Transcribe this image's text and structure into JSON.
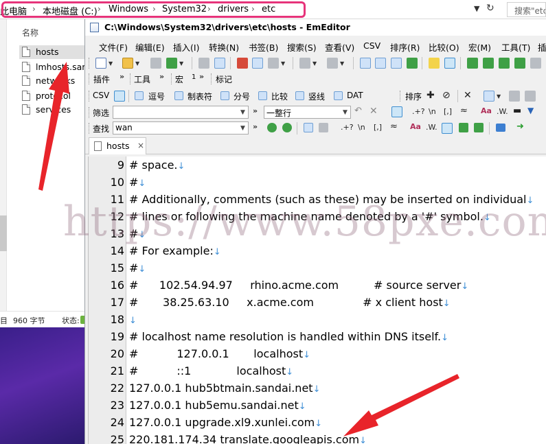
{
  "explorer": {
    "breadcrumb": [
      "此电脑",
      "本地磁盘 (C:)",
      "Windows",
      "System32",
      "drivers",
      "etc"
    ],
    "search_placeholder": "搜索\"etc\"",
    "column_header": "名称",
    "files": [
      {
        "name": "hosts",
        "selected": true
      },
      {
        "name": "lmhosts.sam",
        "selected": false
      },
      {
        "name": "networks",
        "selected": false
      },
      {
        "name": "protocol",
        "selected": false
      },
      {
        "name": "services",
        "selected": false
      }
    ],
    "status": {
      "count_suffix": "目",
      "size": "960 字节",
      "label": "状态:"
    }
  },
  "editor": {
    "title": "C:\\Windows\\System32\\drivers\\etc\\hosts - EmEditor",
    "menu": [
      "文件(F)",
      "编辑(E)",
      "插入(I)",
      "转换(N)",
      "书签(B)",
      "搜索(S)",
      "查看(V)",
      "CSV",
      "排序(R)",
      "比较(O)",
      "宏(M)",
      "工具(T)",
      "插"
    ],
    "toolbar2": {
      "plugins": "插件",
      "tools": "工具",
      "macro": "宏",
      "macro_extra": "1",
      "marks": "标记"
    },
    "csv_bar": {
      "csv": "CSV",
      "comma": "逗号",
      "tab": "制表符",
      "semicolon": "分号",
      "compare": "比较",
      "bar": "竖线",
      "dat": "DAT",
      "sort": "排序"
    },
    "filter_bar": {
      "label": "筛选",
      "value": "",
      "mode": "一整行"
    },
    "find_bar": {
      "label": "查找",
      "value": "wan"
    },
    "toolbar_glyphs": {
      "regex": ".+?",
      "newline": "\\n",
      "brackets": "[,]",
      "fuzzy": "≈",
      "case": "Aa",
      "word": ".W."
    },
    "tab_name": "hosts",
    "tab_close": "×",
    "lines": [
      {
        "n": "9",
        "text": "# space."
      },
      {
        "n": "10",
        "text": "#"
      },
      {
        "n": "11",
        "text": "# Additionally, comments (such as these) may be inserted on individual"
      },
      {
        "n": "12",
        "text": "# lines or following the machine name denoted by a '#' symbol."
      },
      {
        "n": "13",
        "text": "#"
      },
      {
        "n": "14",
        "text": "# For example:"
      },
      {
        "n": "15",
        "text": "#"
      },
      {
        "n": "16",
        "text": "#      102.54.94.97     rhino.acme.com          # source server"
      },
      {
        "n": "17",
        "text": "#       38.25.63.10     x.acme.com              # x client host"
      },
      {
        "n": "18",
        "text": ""
      },
      {
        "n": "19",
        "text": "# localhost name resolution is handled within DNS itself."
      },
      {
        "n": "20",
        "text": "#           127.0.0.1       localhost"
      },
      {
        "n": "21",
        "text": "#           ::1             localhost"
      },
      {
        "n": "22",
        "text": "127.0.0.1 hub5btmain.sandai.net"
      },
      {
        "n": "23",
        "text": "127.0.0.1 hub5emu.sandai.net"
      },
      {
        "n": "24",
        "text": "127.0.0.1 upgrade.xl9.xunlei.com"
      },
      {
        "n": "25",
        "text": "220.181.174.34 translate.googleapis.com"
      }
    ],
    "eol_glyph": "↓"
  },
  "watermark": "https://www.58pxe.com",
  "colors": {
    "highlight": "#e6337a",
    "arrow": "#e8242a",
    "eol": "#3f8fd6",
    "gutter": "#ececec"
  }
}
